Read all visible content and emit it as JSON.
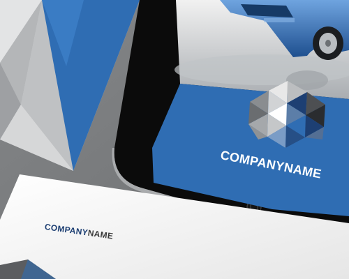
{
  "tablet": {
    "logo": {
      "text": "COMPANYNAME"
    }
  },
  "card": {
    "logo": {
      "part_a": "COMPANY",
      "part_b": "NAME"
    }
  },
  "colors": {
    "brand_blue": "#2f6db3",
    "dark_blue": "#1d3f73",
    "surface_gray": "#77797b",
    "paper_white": "#f6f6f6",
    "device_black": "#0b0b0b"
  }
}
